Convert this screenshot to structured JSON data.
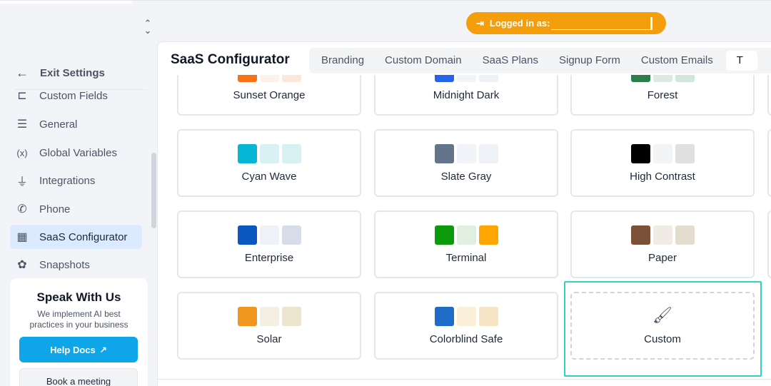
{
  "topbar": {
    "logged_in_label": "Logged in as:",
    "logout_icon": "logout-arrow-icon",
    "toggle_icon": "chevron-up-down-icon"
  },
  "sidebar": {
    "exit_label": "Exit Settings",
    "items": [
      {
        "label": "Custom Fields",
        "icon": "form-field-icon",
        "glyph": "⊏"
      },
      {
        "label": "General",
        "icon": "sliders-icon",
        "glyph": "☰"
      },
      {
        "label": "Global Variables",
        "icon": "variable-icon",
        "glyph": "(x)"
      },
      {
        "label": "Integrations",
        "icon": "plug-icon",
        "glyph": "⏚"
      },
      {
        "label": "Phone",
        "icon": "phone-icon",
        "glyph": "✆"
      },
      {
        "label": "SaaS Configurator",
        "icon": "layout-icon",
        "glyph": "▦"
      },
      {
        "label": "Snapshots",
        "icon": "snapshot-icon",
        "glyph": "✿"
      }
    ],
    "help": {
      "title": "Speak With Us",
      "subtitle": "We implement AI best practices in your business",
      "help_docs_label": "Help Docs",
      "meeting_label": "Book a meeting"
    }
  },
  "main": {
    "title": "SaaS Configurator",
    "tabs": [
      "Branding",
      "Custom Domain",
      "SaaS Plans",
      "Signup Form",
      "Custom Emails",
      "T"
    ],
    "themes": [
      {
        "name": "Sunset Orange",
        "colors": [
          "#f97316",
          "#fdf2e9",
          "#fbe7dc"
        ]
      },
      {
        "name": "Midnight Dark",
        "colors": [
          "#2563eb",
          "#f1f5f9",
          "#eef2f7"
        ]
      },
      {
        "name": "Forest",
        "colors": [
          "#2e7d4f",
          "#dcebe2",
          "#d1e7da"
        ]
      },
      {
        "name": "Cyan Wave",
        "colors": [
          "#06b6d4",
          "#d9f1f5",
          "#d7f0f4"
        ]
      },
      {
        "name": "Slate Gray",
        "colors": [
          "#64748b",
          "#f1f5f9",
          "#eef2f7"
        ]
      },
      {
        "name": "High Contrast",
        "colors": [
          "#000000",
          "#f3f4f6",
          "#e0e0e0"
        ]
      },
      {
        "name": "Enterprise",
        "colors": [
          "#0a58bf",
          "#eef2f7",
          "#d6dde8"
        ]
      },
      {
        "name": "Terminal",
        "colors": [
          "#0b9a0b",
          "#e0efe0",
          "#ffa500"
        ]
      },
      {
        "name": "Paper",
        "colors": [
          "#7b5238",
          "#f0ece4",
          "#e3dccf"
        ]
      },
      {
        "name": "Solar",
        "colors": [
          "#f0961e",
          "#f3efe2",
          "#ede4cf"
        ]
      },
      {
        "name": "Colorblind Safe",
        "colors": [
          "#1f6bc7",
          "#fbefd9",
          "#f7e6c6"
        ]
      }
    ],
    "custom_label": "Custom",
    "custom_icon": "paint-brush-icon"
  }
}
